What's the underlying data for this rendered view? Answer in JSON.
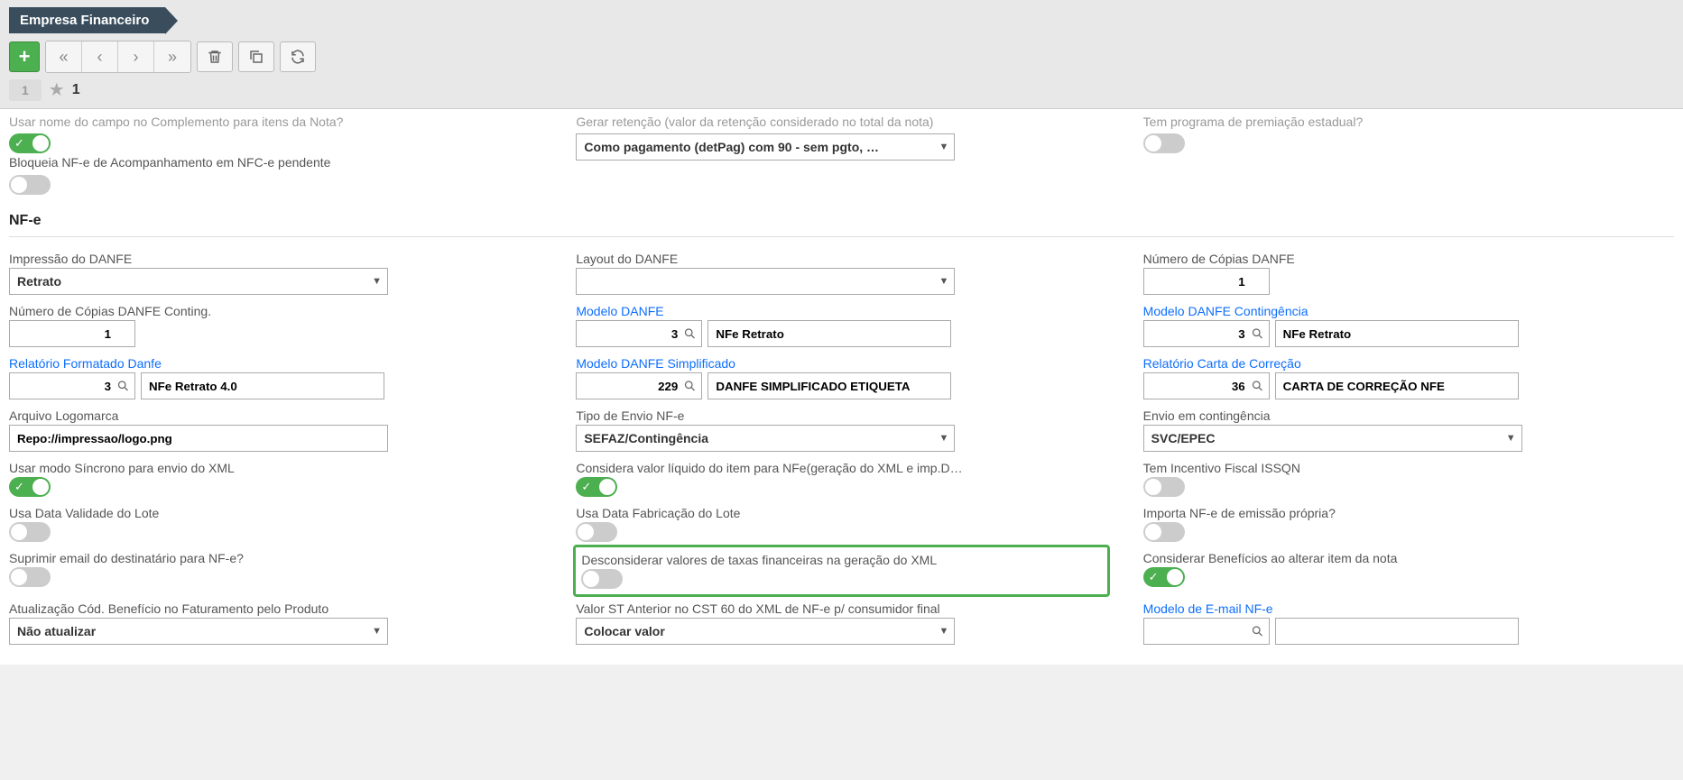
{
  "header": {
    "breadcrumb": "Empresa Financeiro"
  },
  "record": {
    "current": "1",
    "count": "1"
  },
  "top_partial": {
    "col1_label_cut": "Usar nome do campo no Complemento para itens da Nota?",
    "col1_label2": "Bloqueia NF-e de Acompanhamento em NFC-e pendente",
    "col2_label_cut": "Gerar retenção (valor da retenção considerado no total da nota)",
    "col2_select": "Como pagamento (detPag) com 90 - sem pgto, …",
    "col3_label_cut": "Tem programa de premiação estadual?"
  },
  "section_nfe": "NF-e",
  "nfe": {
    "r1c1_label": "Impressão do DANFE",
    "r1c1_value": "Retrato",
    "r1c2_label": "Layout do DANFE",
    "r1c2_value": "",
    "r1c3_label": "Número de Cópias DANFE",
    "r1c3_value": "1",
    "r2c1_label": "Número de Cópias DANFE Conting.",
    "r2c1_value": "1",
    "r2c2_label": "Modelo DANFE",
    "r2c2_num": "3",
    "r2c2_text": "NFe Retrato",
    "r2c3_label": "Modelo DANFE Contingência",
    "r2c3_num": "3",
    "r2c3_text": "NFe Retrato",
    "r3c1_label": "Relatório Formatado Danfe",
    "r3c1_num": "3",
    "r3c1_text": "NFe Retrato 4.0",
    "r3c2_label": "Modelo DANFE Simplificado",
    "r3c2_num": "229",
    "r3c2_text": "DANFE SIMPLIFICADO ETIQUETA",
    "r3c3_label": "Relatório Carta de Correção",
    "r3c3_num": "36",
    "r3c3_text": "CARTA DE CORREÇÃO NFE",
    "r4c1_label": "Arquivo Logomarca",
    "r4c1_value": "Repo://impressao/logo.png",
    "r4c2_label": "Tipo de Envio NF-e",
    "r4c2_value": "SEFAZ/Contingência",
    "r4c3_label": "Envio em contingência",
    "r4c3_value": "SVC/EPEC",
    "r5c1_label": "Usar modo Síncrono para envio do XML",
    "r5c2_label": "Considera valor líquido do item para NFe(geração do XML e imp.D…",
    "r5c3_label": "Tem Incentivo Fiscal ISSQN",
    "r6c1_label": "Usa Data Validade do Lote",
    "r6c2_label": "Usa Data Fabricação do Lote",
    "r6c3_label": "Importa NF-e de emissão própria?",
    "r7c1_label": "Suprimir email do destinatário para NF-e?",
    "r7c2_label": "Desconsiderar valores de taxas financeiras na geração do XML",
    "r7c3_label": "Considerar Benefícios ao alterar item da nota",
    "r8c1_label": "Atualização Cód. Benefício no Faturamento pelo Produto",
    "r8c1_value": "Não atualizar",
    "r8c2_label": "Valor ST Anterior no CST 60 do XML de NF-e p/ consumidor final",
    "r8c2_value": "Colocar valor",
    "r8c3_label": "Modelo de E-mail NF-e",
    "r8c3_num": "",
    "r8c3_text": ""
  }
}
